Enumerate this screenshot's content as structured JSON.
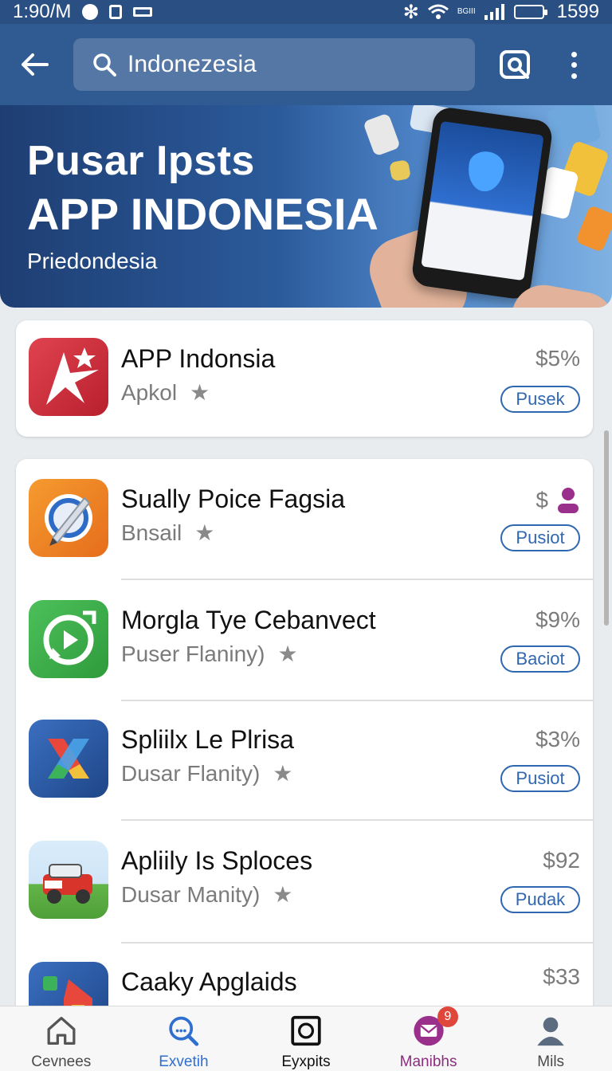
{
  "status_bar": {
    "time": "1:90/M",
    "signal_text": "BGIII",
    "battery_text": "1599"
  },
  "app_bar": {
    "search_value": "Indonezesia"
  },
  "banner": {
    "title_line1": "Pusar Ipsts",
    "title_line2": "APP INDONESIA",
    "subtitle": "Priedondesia"
  },
  "featured": {
    "name": "APP Indonsia",
    "subtitle": "Apkol",
    "price": "$5%",
    "action": "Pusek",
    "icon": "star-arrow-icon",
    "icon_color": "#d63541"
  },
  "apps": [
    {
      "name": "Sually Poice Fagsia",
      "subtitle": "Bnsail",
      "price": "$",
      "action": "Pusiot",
      "icon": "compass-pen-icon",
      "icon_color": "#f07f22"
    },
    {
      "name": "Morgla Tye Cebanvect",
      "subtitle": "Puser Flaniny)",
      "price": "$9%",
      "action": "Baciot",
      "icon": "play-chat-icon",
      "icon_color": "#3caa45"
    },
    {
      "name": "Spliilx Le Plrisa",
      "subtitle": "Dusar Flanity)",
      "price": "$3%",
      "action": "Pusiot",
      "icon": "x-logo-icon",
      "icon_color": "#2c5aa8"
    },
    {
      "name": "Apliily Is Sploces",
      "subtitle": "Dusar Manity)",
      "price": "$92",
      "action": "Pudak",
      "icon": "car-icon",
      "icon_color": "#4aa0e0"
    },
    {
      "name": "Caaky Apglaids",
      "subtitle": "",
      "price": "$33",
      "action": "",
      "icon": "map-pin-icon",
      "icon_color": "#2c5aa8"
    }
  ],
  "bottom_nav": [
    {
      "label": "Cevnees",
      "icon": "home-icon"
    },
    {
      "label": "Exvetih",
      "icon": "search-icon"
    },
    {
      "label": "Eyxpits",
      "icon": "square-icon"
    },
    {
      "label": "Manibhs",
      "icon": "mail-icon",
      "badge": "9"
    },
    {
      "label": "Mils",
      "icon": "person-icon"
    }
  ],
  "colors": {
    "app_bar": "#2f5a92",
    "accent": "#2f67b0",
    "mail_accent": "#8e2c7e",
    "badge": "#e0473c"
  }
}
